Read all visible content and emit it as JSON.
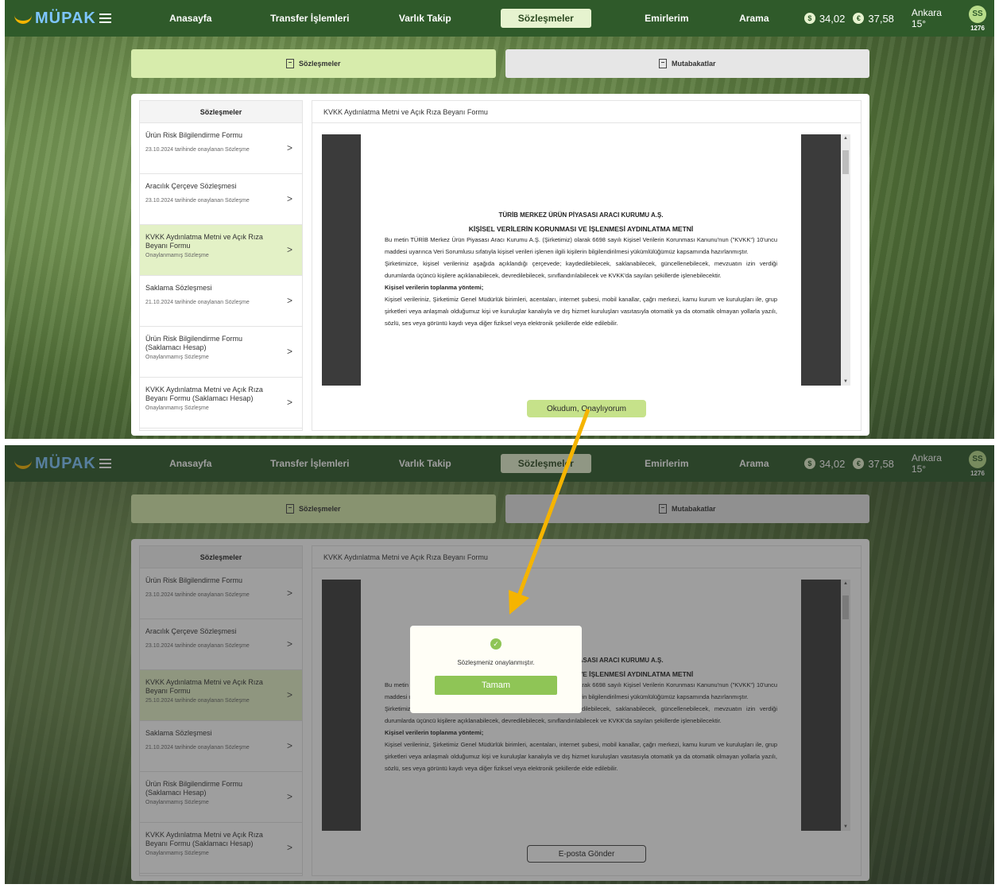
{
  "header": {
    "logo": "MÜPAK",
    "nav": [
      "Anasayfa",
      "Transfer İşlemleri",
      "Varlık Takip",
      "Sözleşmeler",
      "Emirlerim",
      "Arama"
    ],
    "active_nav": "Sözleşmeler",
    "quote1": "34,02",
    "quote2": "37,58",
    "weather": "Ankara 15°",
    "avatar_initials": "SS",
    "avatar_code": "1276"
  },
  "tabs": {
    "contracts": "Sözleşmeler",
    "reconciliations": "Mutabakatlar"
  },
  "sidebar": {
    "title": "Sözleşmeler",
    "items_top": [
      {
        "title": "Ürün Risk Bilgilendirme Formu",
        "sub": "23.10.2024 tarihinde onaylanan Sözleşme"
      },
      {
        "title": "Aracılık Çerçeve Sözleşmesi",
        "sub": "23.10.2024 tarihinde onaylanan Sözleşme"
      },
      {
        "title": "KVKK Aydınlatma Metni ve Açık Rıza Beyanı Formu",
        "sub": "Onaylanmamış Sözleşme"
      },
      {
        "title": "Saklama Sözleşmesi",
        "sub": "21.10.2024 tarihinde onaylanan Sözleşme"
      },
      {
        "title": "Ürün Risk Bilgilendirme Formu (Saklamacı Hesap)",
        "sub": "Onaylanmamış Sözleşme"
      },
      {
        "title": "KVKK Aydınlatma Metni ve Açık Rıza Beyanı Formu (Saklamacı Hesap)",
        "sub": "Onaylanmamış Sözleşme"
      }
    ],
    "items_bottom": [
      {
        "title": "Ürün Risk Bilgilendirme Formu",
        "sub": "23.10.2024 tarihinde onaylanan Sözleşme"
      },
      {
        "title": "Aracılık Çerçeve Sözleşmesi",
        "sub": "23.10.2024 tarihinde onaylanan Sözleşme"
      },
      {
        "title": "KVKK Aydınlatma Metni ve Açık Rıza Beyanı Formu",
        "sub": "25.10.2024 tarihinde onaylanan Sözleşme"
      },
      {
        "title": "Saklama Sözleşmesi",
        "sub": "21.10.2024 tarihinde onaylanan Sözleşme"
      },
      {
        "title": "Ürün Risk Bilgilendirme Formu (Saklamacı Hesap)",
        "sub": "Onaylanmamış Sözleşme"
      },
      {
        "title": "KVKK Aydınlatma Metni ve Açık Rıza Beyanı Formu (Saklamacı Hesap)",
        "sub": "Onaylanmamış Sözleşme"
      }
    ]
  },
  "document": {
    "panel_title": "KVKK Aydınlatma Metni ve Açık Rıza Beyanı Formu",
    "heading1": "TÜRİB MERKEZ ÜRÜN PİYASASI ARACI KURUMU A.Ş.",
    "heading2": "KİŞİSEL VERİLERİN KORUNMASI VE İŞLENMESİ AYDINLATMA METNİ",
    "p1": "Bu metin TÜRİB Merkez Ürün Piyasası Aracı Kurumu A.Ş. (Şirketimiz) olarak 6698 sayılı Kişisel Verilerin Korunması Kanunu'nun (\"KVKK\") 10'uncu maddesi uyarınca Veri Sorumlusu sıfatıyla kişisel verileri işlenen ilgili kişilerin bilgilendirilmesi yükümlülüğümüz kapsamında hazırlanmıştır.",
    "p2": "Şirketimizce, kişisel verileriniz aşağıda açıklandığı çerçevede; kaydedilebilecek, saklanabilecek, güncellenebilecek, mevzuatın izin verdiği durumlarda üçüncü kişilere açıklanabilecek, devredilebilecek, sınıflandırılabilecek ve KVKK'da sayılan şekillerde işlenebilecektir.",
    "h3": "Kişisel verilerin toplanma yöntemi;",
    "p3": "Kişisel verileriniz, Şirketimiz Genel Müdürlük birimleri, acentaları, internet şubesi, mobil kanallar, çağrı merkezi, kamu kurum ve kuruluşları ile, grup şirketleri veya anlaşmalı olduğumuz kişi ve kuruluşlar kanalıyla ve dış hizmet kuruluşları vasıtasıyla otomatik ya da otomatik olmayan yollarla yazılı, sözlü, ses veya görüntü kaydı veya diğer fiziksel veya elektronik şekillerde elde edilebilir."
  },
  "buttons": {
    "approve": "Okudum, Onaylıyorum",
    "email": "E-posta Gönder"
  },
  "modal": {
    "message": "Sözleşmeniz onaylanmıştır.",
    "ok": "Tamam"
  },
  "colors": {
    "topbar": "#2f5a2a",
    "accent": "#c6e28a",
    "arrow": "#f5b400"
  }
}
